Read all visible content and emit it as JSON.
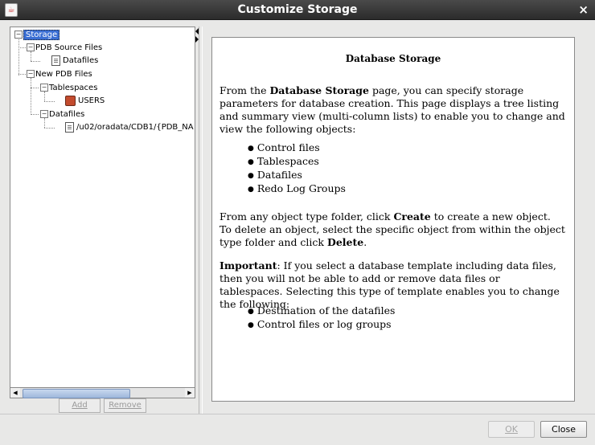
{
  "window": {
    "title": "Customize Storage",
    "close_glyph": "×",
    "app_icon_glyph": "☕"
  },
  "tree": {
    "nodes": [
      {
        "label": "Storage",
        "icon": "none",
        "selected": true
      },
      {
        "label": "PDB Source Files",
        "icon": "none"
      },
      {
        "label": "Datafiles",
        "icon": "document-icon"
      },
      {
        "label": "New PDB Files",
        "icon": "none"
      },
      {
        "label": "Tablespaces",
        "icon": "none"
      },
      {
        "label": "USERS",
        "icon": "tablespace-icon"
      },
      {
        "label": "Datafiles",
        "icon": "none"
      },
      {
        "label": "/u02/oradata/CDB1/{PDB_NA",
        "icon": "document-icon"
      }
    ],
    "add_label": "Add",
    "remove_label": "Remove"
  },
  "help": {
    "heading": "Database Storage",
    "p1_a": "From the ",
    "p1_b": "Database Storage",
    "p1_c": " page, you can specify storage parameters for database creation. This page displays a tree listing and summary view (multi-column lists) to enable you to change and view the following objects:",
    "list1": [
      "Control files",
      "Tablespaces",
      "Datafiles",
      "Redo Log Groups"
    ],
    "p2_a": "From any object type folder, click ",
    "p2_b": "Create",
    "p2_c": " to create a new object. To delete an object, select the specific object from within the object type folder and click ",
    "p2_d": "Delete",
    "p2_e": ".",
    "p3_a": "Important",
    "p3_b": ": If you select a database template including data files, then you will not be able to add or remove data files or tablespaces. Selecting this type of template enables you to change the following:",
    "list2": [
      "Destination of the datafiles",
      "Control files or log groups"
    ]
  },
  "buttons": {
    "ok_label": "OK",
    "close_label": "Close"
  }
}
